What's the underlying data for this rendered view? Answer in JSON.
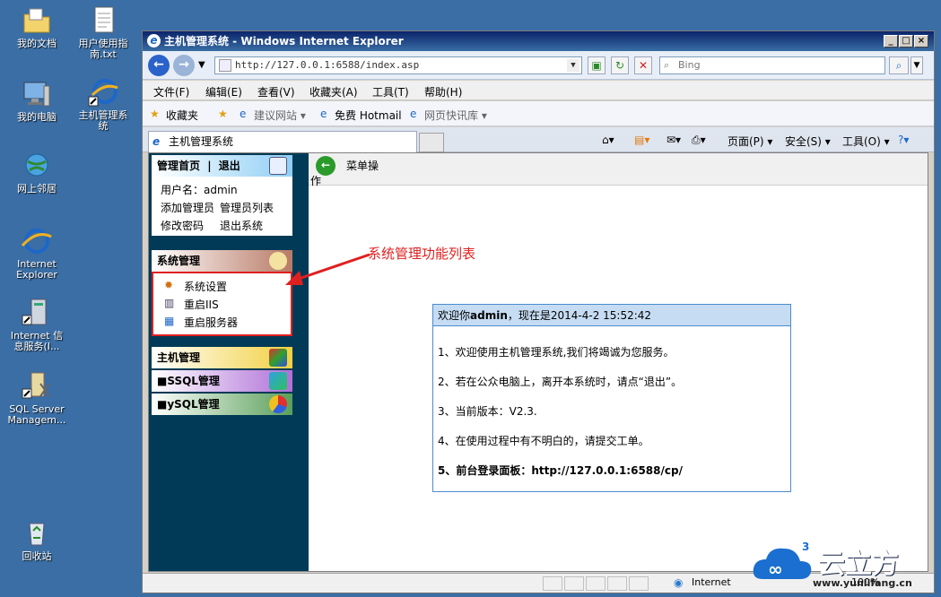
{
  "desktop": {
    "icons": [
      {
        "label": "我的文档",
        "icon": "folder-documents-icon"
      },
      {
        "label": "用户使用指\n南.txt",
        "icon": "text-file-icon"
      },
      {
        "label": "我的电脑",
        "icon": "computer-icon"
      },
      {
        "label": "主机管理系\n统",
        "icon": "ie-shortcut-icon"
      },
      {
        "label": "网上邻居",
        "icon": "network-icon"
      },
      {
        "label": "Internet\nExplorer",
        "icon": "ie-icon"
      },
      {
        "label": "Internet 信\n息服务(I...",
        "icon": "iis-icon"
      },
      {
        "label": "SQL Server\nManagem...",
        "icon": "sql-server-icon"
      },
      {
        "label": "回收站",
        "icon": "recycle-bin-icon"
      }
    ]
  },
  "window": {
    "title": "主机管理系统 - Windows Internet Explorer",
    "address": "http://127.0.0.1:6588/index.asp",
    "search_placeholder": "Bing",
    "menu": [
      "文件(F)",
      "编辑(E)",
      "查看(V)",
      "收藏夹(A)",
      "工具(T)",
      "帮助(H)"
    ],
    "favorites_label": "收藏夹",
    "fav_items": [
      "建议网站 ▾",
      "免费 Hotmail",
      "网页快讯库 ▾"
    ],
    "tab_title": "主机管理系统",
    "tab_tools": [
      "页面(P) ▾",
      "安全(S) ▾",
      "工具(O) ▾"
    ],
    "status_zone": "Internet",
    "status_zoom": "100%"
  },
  "sidebar": {
    "home_link": "管理首页",
    "logout_link": "退出",
    "username_label": "用户名：admin",
    "links": [
      "添加管理员",
      "管理员列表",
      "修改密码",
      "退出系统"
    ],
    "sys_title": "系统管理",
    "sys_items": [
      "系统设置",
      "重启IIS",
      "重启服务器"
    ],
    "host_title": "主机管理",
    "mssql_title": "■SSQL管理",
    "mysql_title": "■ySQL管理"
  },
  "content": {
    "menu_op_label": "菜单操",
    "menu_op_label_wrap": "作",
    "welcome_title_prefix": "欢迎你",
    "welcome_user": "admin",
    "welcome_title_suffix": "，现在是2014-4-2 15:52:42",
    "lines": [
      "1、欢迎使用主机管理系统,我们将竭诚为您服务。",
      "2、若在公众电脑上，离开本系统时，请点“退出”。",
      "3、当前版本：V2.3.",
      "4、在使用过程中有不明白的，请提交工单。",
      "5、前台登录面板：http://127.0.0.1:6588/cp/"
    ]
  },
  "annotation": {
    "text": "系统管理功能列表",
    "color": "#e02020"
  },
  "watermark": {
    "brand": "云立方",
    "url": "www.yunlifang.cn"
  }
}
